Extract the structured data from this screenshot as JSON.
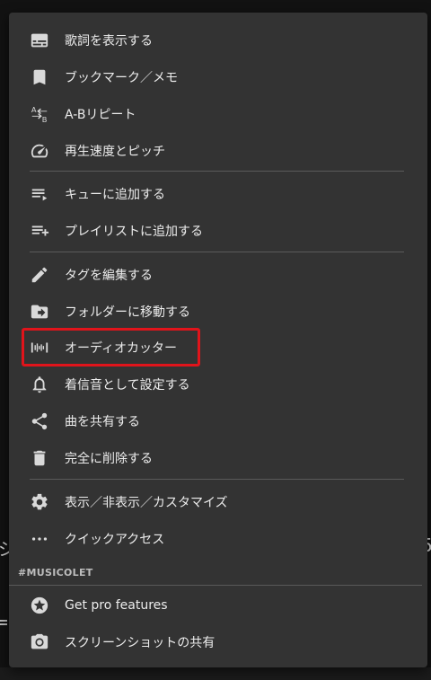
{
  "background": {
    "left_glyph": "ジ",
    "right_glyph": "5"
  },
  "menu": {
    "items": [
      {
        "id": "show-lyrics",
        "icon": "subtitles-icon",
        "label": "歌詞を表示する"
      },
      {
        "id": "bookmark-memo",
        "icon": "bookmark-icon",
        "label": "ブックマーク／メモ"
      },
      {
        "id": "ab-repeat",
        "icon": "ab-repeat-icon",
        "label": "A-Bリピート"
      },
      {
        "id": "speed-pitch",
        "icon": "speedometer-icon",
        "label": "再生速度とピッチ"
      },
      {
        "id": "add-to-queue",
        "icon": "queue-icon",
        "label": "キューに追加する"
      },
      {
        "id": "add-to-playlist",
        "icon": "playlist-add-icon",
        "label": "プレイリストに追加する"
      },
      {
        "id": "edit-tags",
        "icon": "pencil-icon",
        "label": "タグを編集する"
      },
      {
        "id": "move-to-folder",
        "icon": "folder-move-icon",
        "label": "フォルダーに移動する"
      },
      {
        "id": "audio-cutter",
        "icon": "audio-cutter-icon",
        "label": "オーディオカッター"
      },
      {
        "id": "set-ringtone",
        "icon": "bell-icon",
        "label": "着信音として設定する"
      },
      {
        "id": "share-song",
        "icon": "share-icon",
        "label": "曲を共有する"
      },
      {
        "id": "delete-completely",
        "icon": "trash-icon",
        "label": "完全に削除する"
      },
      {
        "id": "customize",
        "icon": "gear-icon",
        "label": "表示／非表示／カスタマイズ"
      },
      {
        "id": "quick-access",
        "icon": "more-horizontal-icon",
        "label": "クイックアクセス"
      }
    ],
    "section_header": "#MUSICOLET",
    "section_items": [
      {
        "id": "get-pro",
        "icon": "star-badge-icon",
        "label": "Get pro features"
      },
      {
        "id": "share-screenshot",
        "icon": "camera-icon",
        "label": "スクリーンショットの共有"
      }
    ],
    "highlighted_item": "audio-cutter",
    "highlight_color": "#e0141b"
  }
}
